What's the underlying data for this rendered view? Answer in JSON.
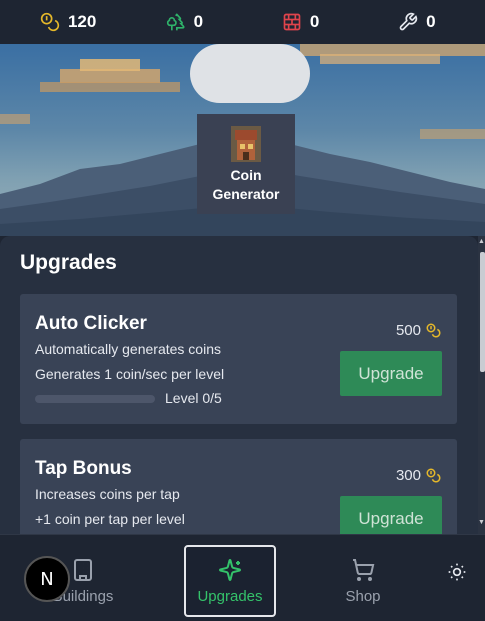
{
  "resources": {
    "coins": "120",
    "wood": "0",
    "bricks": "0",
    "tools": "0"
  },
  "scene": {
    "building": {
      "name_line1": "Coin",
      "name_line2": "Generator"
    }
  },
  "upgrades_panel": {
    "title": "Upgrades",
    "items": [
      {
        "title": "Auto Clicker",
        "description": "Automatically generates coins",
        "rate": "Generates 1 coin/sec per level",
        "cost": "500",
        "button_label": "Upgrade",
        "level_text": "Level 0/5",
        "level_progress": 0
      },
      {
        "title": "Tap Bonus",
        "description": "Increases coins per tap",
        "rate": "+1 coin per tap per level",
        "cost": "300",
        "button_label": "Upgrade"
      }
    ]
  },
  "nav": {
    "buildings": "Buildings",
    "upgrades": "Upgrades",
    "shop": "Shop"
  },
  "dev_badge": "N",
  "colors": {
    "accent_green": "#34c26a",
    "button_green": "#2e8a57",
    "coin_yellow": "#e5b82a",
    "wood_green": "#2fb36a",
    "brick_red": "#e0444c"
  },
  "icons": {
    "coins": "coins-icon",
    "wood": "trees-icon",
    "bricks": "brick-wall-icon",
    "tools": "wrench-icon",
    "buildings": "building-icon",
    "upgrades": "sparkles-icon",
    "shop": "cart-icon",
    "theme": "sun-icon"
  }
}
